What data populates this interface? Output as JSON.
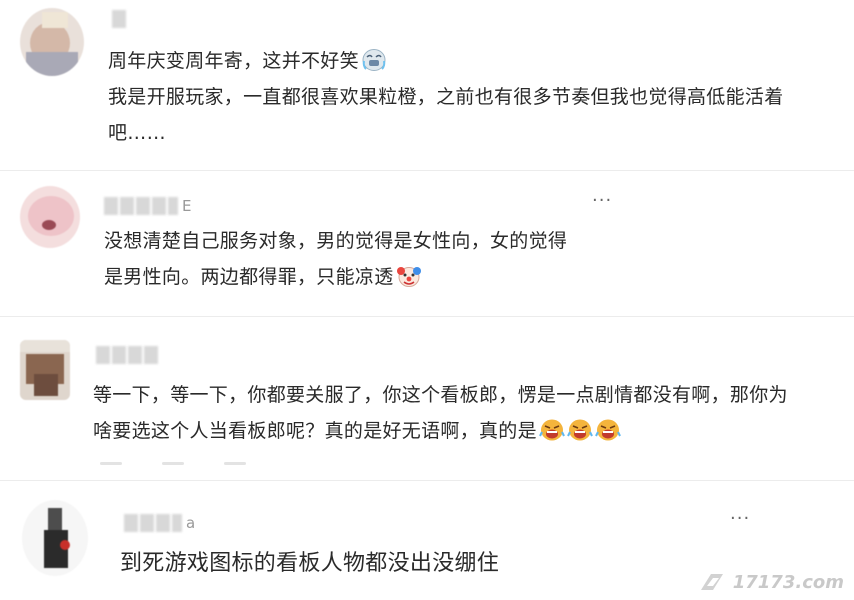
{
  "comments": [
    {
      "username_suffix": "",
      "lines": [
        "周年庆变周年寄，这并不好笑",
        "我是开服玩家，一直都很喜欢果粒橙，之前也有很多节奏但我也觉得高低能活着",
        "吧……"
      ],
      "emoji": "crying-emoji",
      "more": ""
    },
    {
      "username_suffix": "E",
      "lines": [
        "没想清楚自己服务对象，男的觉得是女性向，女的觉得",
        "是男性向。两边都得罪，只能凉透"
      ],
      "emoji": "clown-emoji",
      "more": "···"
    },
    {
      "username_suffix": "",
      "lines": [
        "等一下，等一下，你都要关服了，你这个看板郎，愣是一点剧情都没有啊，那你为",
        "啥要选这个人当看板郎呢？真的是好无语啊，真的是"
      ],
      "emoji": "angry-emoji",
      "more": ""
    },
    {
      "username_suffix": "a",
      "lines": [
        "到死游戏图标的看板人物都没出没绷住"
      ],
      "emoji": "",
      "more": "···"
    }
  ],
  "watermark": {
    "text": "17173.com"
  },
  "colors": {
    "emoji_yellow": "#f7c535",
    "emoji_red": "#e2463d",
    "watermark": "#c9c9c9"
  }
}
